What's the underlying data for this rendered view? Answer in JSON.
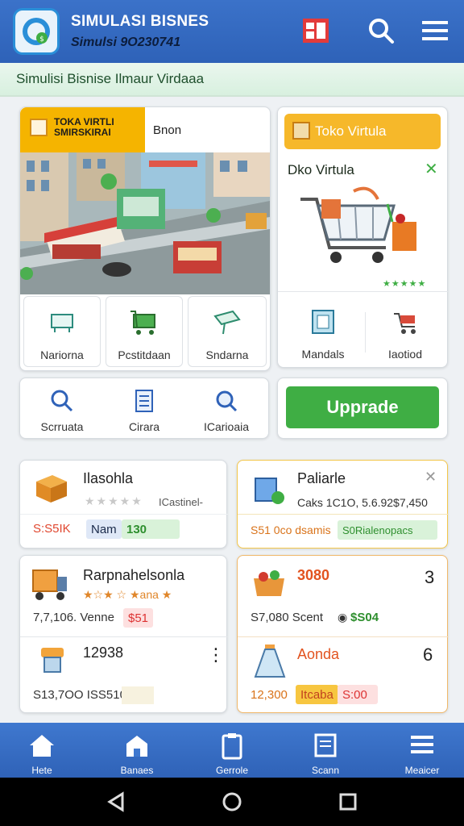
{
  "header": {
    "title": "SIMULASI BISNES",
    "subtitle": "Simulsi 9O230741",
    "icons": [
      "app-logo-icon",
      "store-sale-icon",
      "search-icon",
      "menu-icon"
    ]
  },
  "banner": {
    "text": "Simulisi Bisnise Ilmaur Virdaaa"
  },
  "store_card": {
    "tag": "TOKA VIRTLI SMIRSKIRAI",
    "name": "Bnon",
    "tiles": [
      {
        "label": "Nariorna",
        "icon": "basket-icon"
      },
      {
        "label": "Pcstitdaan",
        "icon": "cart-icon"
      },
      {
        "label": "Sndarna",
        "icon": "sign-icon"
      }
    ]
  },
  "toko_card": {
    "button": "Toko Virtula",
    "heading": "Dko Virtula",
    "rating": "★★★★★",
    "tiles": [
      {
        "label": "Mandals",
        "icon": "book-icon"
      },
      {
        "label": "Iaotiod",
        "icon": "cart-icon"
      }
    ]
  },
  "tools": [
    {
      "label": "Scrruata",
      "icon": "search-icon"
    },
    {
      "label": "Cirara",
      "icon": "document-icon"
    },
    {
      "label": "ICarioaia",
      "icon": "search-icon"
    }
  ],
  "upgrade_label": "Upprade",
  "items": {
    "a": {
      "title": "Ilasohla",
      "rating": "★★★★★",
      "sub": "ICastinel-",
      "price": "S:S5IK",
      "tag1": "Nam",
      "tag2": "130"
    },
    "b": {
      "title": "Paliarle",
      "line": "Caks 1C1O, 5.6.92$7,450",
      "price": "S51 0co dsamis",
      "tag": "S0Rialenopacs"
    },
    "c": {
      "title": "Rarpnahelsonla",
      "rating": "★☆★ ☆ ★ana ★",
      "price": "7,7,106. Venne",
      "tag": "$51"
    },
    "d": {
      "title": "3080",
      "num": "3",
      "price": "S7,080 Scent",
      "tag": "$S04"
    },
    "e": {
      "title": "12938",
      "price": "S13,7OO ISS510"
    },
    "f": {
      "title": "Aonda",
      "num": "6",
      "price": "12,300",
      "tag1": "Itcaba",
      "tag2": "S:00"
    }
  },
  "nav": [
    {
      "label": "Hete",
      "icon": "home-icon"
    },
    {
      "label": "Banaes",
      "icon": "store-icon"
    },
    {
      "label": "Gerrole",
      "icon": "clipboard-icon"
    },
    {
      "label": "Scann",
      "icon": "document-icon"
    },
    {
      "label": "Meaicer",
      "icon": "list-icon"
    }
  ],
  "colors": {
    "primary": "#2f62b8",
    "accent": "#f5b400",
    "success": "#3fae44"
  }
}
